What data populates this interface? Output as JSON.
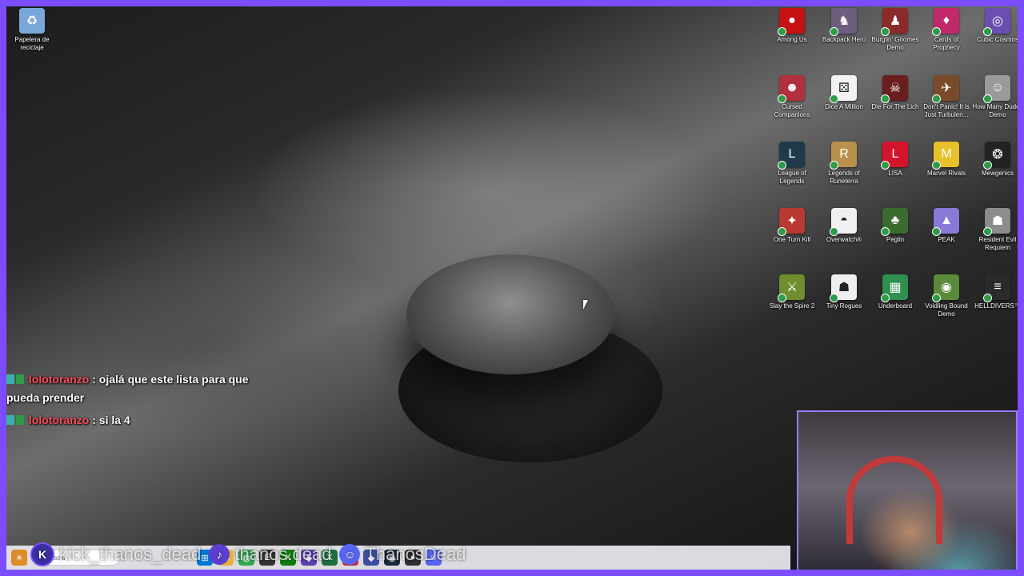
{
  "desktop": {
    "recycle_bin": {
      "label": "Papelera de reciclaje",
      "icon": "recycle-bin-icon",
      "color": "#7aa7d8"
    },
    "icons": [
      {
        "label": "Among Us",
        "icon": "among-us-icon",
        "color": "#c51111",
        "glyph": "●"
      },
      {
        "label": "Backpack Hero",
        "icon": "backpack-hero-icon",
        "color": "#6d5d7e",
        "glyph": "♞"
      },
      {
        "label": "Burglin' Gnomes Demo",
        "icon": "burglin-gnomes-icon",
        "color": "#8b2a2a",
        "glyph": "♟"
      },
      {
        "label": "Cards of Prophecy",
        "icon": "cards-of-prophecy-icon",
        "color": "#c02a6b",
        "glyph": "♦"
      },
      {
        "label": "Cubic Cosmos",
        "icon": "cubic-cosmos-icon",
        "color": "#6a4fb0",
        "glyph": "◎"
      },
      {
        "label": "Cursed Companions",
        "icon": "cursed-companions-icon",
        "color": "#b22f3f",
        "glyph": "☻"
      },
      {
        "label": "Dice A Million",
        "icon": "dice-a-million-icon",
        "color": "#f2f2f2",
        "glyph": "⚄"
      },
      {
        "label": "Die For The Lich",
        "icon": "die-for-the-lich-icon",
        "color": "#6b1e1e",
        "glyph": "☠"
      },
      {
        "label": "Don't Panic! It is Just Turbulen...",
        "icon": "dont-panic-icon",
        "color": "#7a4b2b",
        "glyph": "✈"
      },
      {
        "label": "How Many Dudes Demo",
        "icon": "how-many-dudes-icon",
        "color": "#9a9a9a",
        "glyph": "☺"
      },
      {
        "label": "League of Legends",
        "icon": "league-of-legends-icon",
        "color": "#1f3a4a",
        "glyph": "L"
      },
      {
        "label": "Legends of Runeterra",
        "icon": "legends-of-runeterra-icon",
        "color": "#b8924a",
        "glyph": "R"
      },
      {
        "label": "LISA",
        "icon": "lisa-icon",
        "color": "#d4142a",
        "glyph": "L"
      },
      {
        "label": "Marvel Rivals",
        "icon": "marvel-rivals-icon",
        "color": "#e7c12a",
        "glyph": "M"
      },
      {
        "label": "Mewgenics",
        "icon": "mewgenics-icon",
        "color": "#222222",
        "glyph": "❂"
      },
      {
        "label": "One Turn Kill",
        "icon": "one-turn-kill-icon",
        "color": "#b93a32",
        "glyph": "✦"
      },
      {
        "label": "Overwatch®",
        "icon": "overwatch-icon",
        "color": "#f0f0f0",
        "glyph": "◓"
      },
      {
        "label": "Peglin",
        "icon": "peglin-icon",
        "color": "#3c6b2f",
        "glyph": "♣"
      },
      {
        "label": "PEAK",
        "icon": "peak-icon",
        "color": "#8a7ad8",
        "glyph": "▲"
      },
      {
        "label": "Resident Evil Requiem",
        "icon": "resident-evil-icon",
        "color": "#8c8c8c",
        "glyph": "☗"
      },
      {
        "label": "Slay the Spire 2",
        "icon": "slay-the-spire-icon",
        "color": "#6f8f2f",
        "glyph": "⚔"
      },
      {
        "label": "Tiny Rogues",
        "icon": "tiny-rogues-icon",
        "color": "#efefef",
        "glyph": "☗"
      },
      {
        "label": "Underboard",
        "icon": "underboard-icon",
        "color": "#2f8f4f",
        "glyph": "▦"
      },
      {
        "label": "Voidling Bound Demo",
        "icon": "voidling-bound-icon",
        "color": "#5a8a3a",
        "glyph": "◉"
      },
      {
        "label": "HELLDIVERS™",
        "icon": "helldivers-icon",
        "color": "#2a2a2a",
        "glyph": "≡"
      }
    ]
  },
  "chat": {
    "messages": [
      {
        "user": "lolotoranzo",
        "sep": ":",
        "text": " ojalá que este lista para que",
        "cont": "pueda prender"
      },
      {
        "user": "lolotoranzo",
        "sep": ":",
        "text": " si la 4",
        "cont": ""
      }
    ]
  },
  "overlay": {
    "kick": "kick_thanos_dead",
    "tiktok": "thanos.dead",
    "discord": "ThanosDead"
  },
  "taskbar": {
    "search_placeholder": "Buscar",
    "apps": [
      {
        "icon": "start-icon",
        "color": "#0078d4",
        "glyph": "⊞"
      },
      {
        "icon": "file-explorer-icon",
        "color": "#e7b23a",
        "glyph": "▭"
      },
      {
        "icon": "chrome-icon",
        "color": "#34a853",
        "glyph": "◍"
      },
      {
        "icon": "epic-icon",
        "color": "#333333",
        "glyph": "E"
      },
      {
        "icon": "xbox-icon",
        "color": "#107c10",
        "glyph": "X"
      },
      {
        "icon": "app-purple-icon",
        "color": "#5b3fb0",
        "glyph": "◆"
      },
      {
        "icon": "excel-icon",
        "color": "#1d6f42",
        "glyph": "X"
      },
      {
        "icon": "opera-icon",
        "color": "#d0202a",
        "glyph": "O"
      },
      {
        "icon": "app-blue-icon",
        "color": "#3a4fa0",
        "glyph": "◆"
      },
      {
        "icon": "steam-icon",
        "color": "#1b2838",
        "glyph": "◉"
      },
      {
        "icon": "obs-icon",
        "color": "#302e31",
        "glyph": "●"
      },
      {
        "icon": "discord-taskbar-icon",
        "color": "#5865f2",
        "glyph": "☺"
      }
    ]
  }
}
